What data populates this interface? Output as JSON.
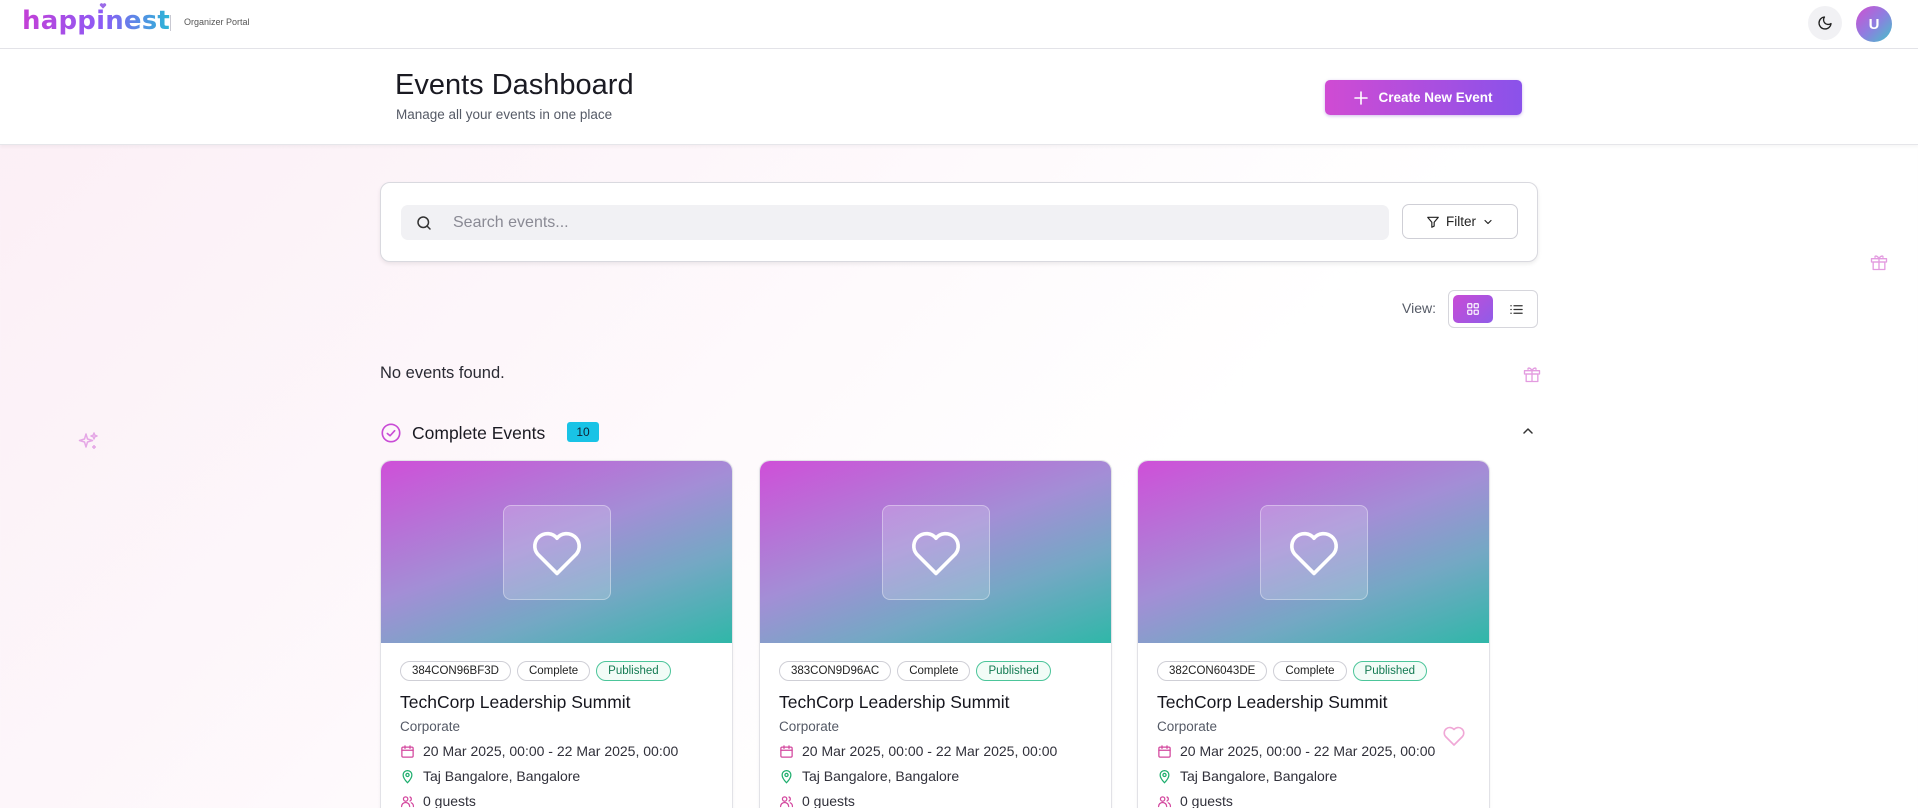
{
  "nav": {
    "logo_text": "happinest",
    "portal_label": "Organizer Portal",
    "avatar_initial": "U",
    "icons": {
      "theme": "moon-icon"
    }
  },
  "header": {
    "title": "Events Dashboard",
    "subtitle": "Manage all your events in one place",
    "create_label": "Create New Event"
  },
  "search": {
    "placeholder": "Search events...",
    "value": "",
    "filter_label": "Filter"
  },
  "view": {
    "label": "View:",
    "selected": "grid"
  },
  "empty_message": "No events found.",
  "section": {
    "title": "Complete Events",
    "count": "10"
  },
  "cards": [
    {
      "code": "384CON96BF3D",
      "status": "Complete",
      "publish": "Published",
      "title": "TechCorp Leadership Summit",
      "category": "Corporate",
      "dates": "20 Mar 2025, 00:00 - 22 Mar 2025, 00:00",
      "location": "Taj Bangalore, Bangalore",
      "guests": "0 guests"
    },
    {
      "code": "383CON9D96AC",
      "status": "Complete",
      "publish": "Published",
      "title": "TechCorp Leadership Summit",
      "category": "Corporate",
      "dates": "20 Mar 2025, 00:00 - 22 Mar 2025, 00:00",
      "location": "Taj Bangalore, Bangalore",
      "guests": "0 guests"
    },
    {
      "code": "382CON6043DE",
      "status": "Complete",
      "publish": "Published",
      "title": "TechCorp Leadership Summit",
      "category": "Corporate",
      "dates": "20 Mar 2025, 00:00 - 22 Mar 2025, 00:00",
      "location": "Taj Bangalore, Bangalore",
      "guests": "0 guests"
    }
  ],
  "colors": {
    "accent": "#c94bd6",
    "accent_end": "#8a52ea",
    "badge": "#19c3e6",
    "published": "#4cc59a"
  }
}
